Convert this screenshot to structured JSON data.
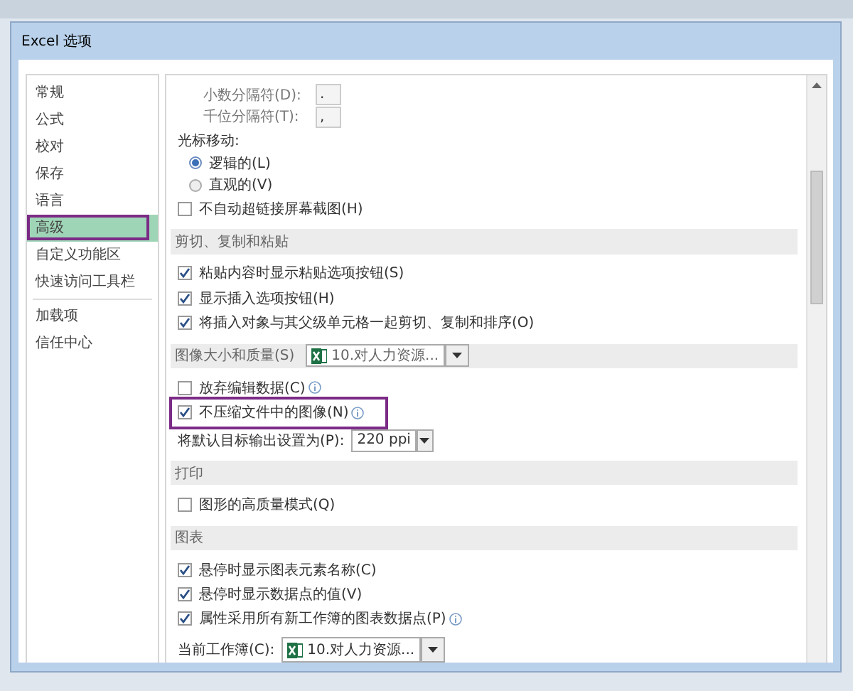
{
  "window": {
    "title": "Excel 选项"
  },
  "sidebar": {
    "items": [
      {
        "label": "常规",
        "selected": false,
        "highlighted": false,
        "divider_after": false
      },
      {
        "label": "公式",
        "selected": false,
        "highlighted": false,
        "divider_after": false
      },
      {
        "label": "校对",
        "selected": false,
        "highlighted": false,
        "divider_after": false
      },
      {
        "label": "保存",
        "selected": false,
        "highlighted": false,
        "divider_after": false
      },
      {
        "label": "语言",
        "selected": false,
        "highlighted": false,
        "divider_after": false
      },
      {
        "label": "高级",
        "selected": true,
        "highlighted": true,
        "divider_after": false
      },
      {
        "label": "自定义功能区",
        "selected": false,
        "highlighted": false,
        "divider_after": false
      },
      {
        "label": "快速访问工具栏",
        "selected": false,
        "highlighted": false,
        "divider_after": true
      },
      {
        "label": "加载项",
        "selected": false,
        "highlighted": false,
        "divider_after": false
      },
      {
        "label": "信任中心",
        "selected": false,
        "highlighted": false,
        "divider_after": false
      }
    ]
  },
  "content": {
    "rows": [
      {
        "kind": "field",
        "label": "小数分隔符(D):",
        "value": "."
      },
      {
        "kind": "field",
        "label": "千位分隔符(T):",
        "value": ","
      },
      {
        "kind": "label",
        "label": "光标移动:"
      },
      {
        "kind": "radio",
        "label": "逻辑的(L)",
        "selected": true
      },
      {
        "kind": "radio",
        "label": "直观的(V)",
        "selected": false
      },
      {
        "kind": "checkbox",
        "label": "不自动超链接屏幕截图(H)",
        "checked": false,
        "info": false,
        "highlighted": false
      },
      {
        "kind": "section",
        "label": "剪切、复制和粘贴"
      },
      {
        "kind": "checkbox",
        "label": "粘贴内容时显示粘贴选项按钮(S)",
        "checked": true,
        "info": false,
        "highlighted": false
      },
      {
        "kind": "checkbox",
        "label": "显示插入选项按钮(H)",
        "checked": true,
        "info": false,
        "highlighted": false
      },
      {
        "kind": "checkbox",
        "label": "将插入对象与其父级单元格一起剪切、复制和排序(O)",
        "checked": true,
        "info": false,
        "highlighted": false
      },
      {
        "kind": "section",
        "label": "图像大小和质量(S)",
        "dropdown": "10.对人力资源..."
      },
      {
        "kind": "checkbox",
        "label": "放弃编辑数据(C)",
        "checked": false,
        "info": true,
        "highlighted": false
      },
      {
        "kind": "checkbox",
        "label": "不压缩文件中的图像(N)",
        "checked": true,
        "info": true,
        "highlighted": true
      },
      {
        "kind": "select",
        "label": "将默认目标输出设置为(P):",
        "value": "220 ppi"
      },
      {
        "kind": "section",
        "label": "打印"
      },
      {
        "kind": "checkbox",
        "label": "图形的高质量模式(Q)",
        "checked": false,
        "info": false,
        "highlighted": false
      },
      {
        "kind": "section",
        "label": "图表"
      },
      {
        "kind": "checkbox",
        "label": "悬停时显示图表元素名称(C)",
        "checked": true,
        "info": false,
        "highlighted": false
      },
      {
        "kind": "checkbox",
        "label": "悬停时显示数据点的值(V)",
        "checked": true,
        "info": false,
        "highlighted": false
      },
      {
        "kind": "checkbox",
        "label": "属性采用所有新工作簿的图表数据点(P)",
        "checked": true,
        "info": true,
        "highlighted": false
      },
      {
        "kind": "workbook",
        "label": "当前工作簿(C):",
        "dropdown": "10.对人力资源..."
      }
    ]
  }
}
